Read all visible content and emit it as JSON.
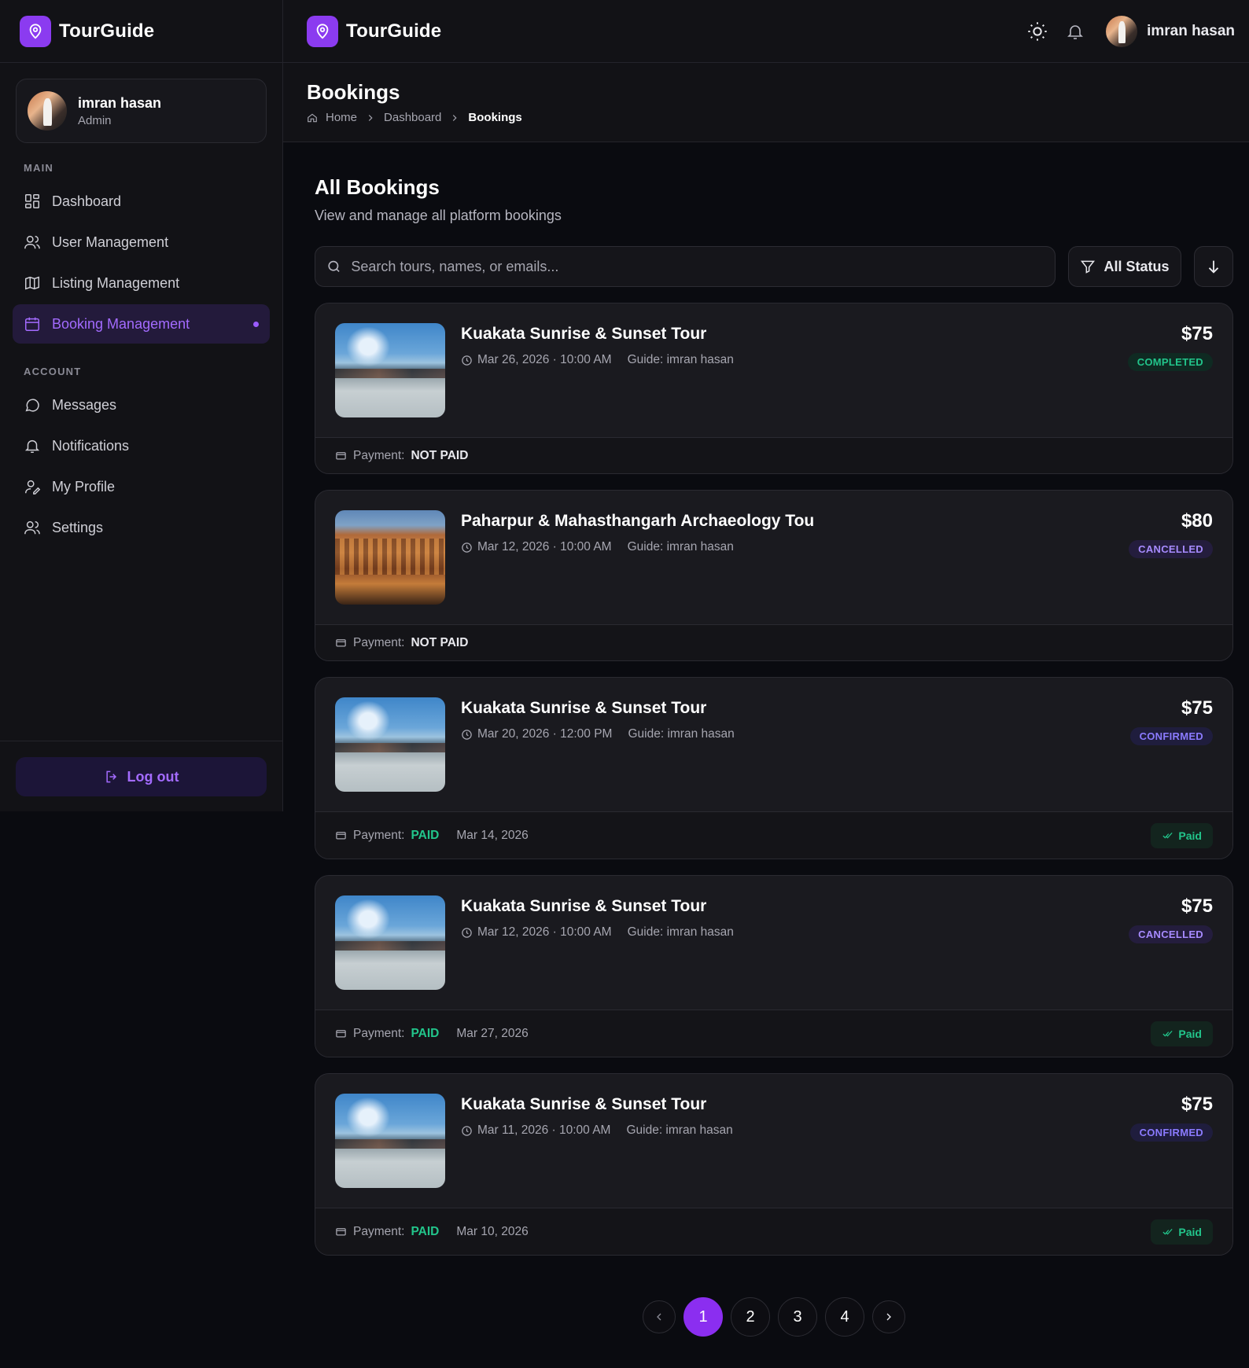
{
  "app": {
    "brand": "TourGuide"
  },
  "colors": {
    "accent": "#8b2ef0",
    "completed": "#22c58b",
    "cancelled": "#a78bff",
    "confirmed": "#8b7bff",
    "paid": "#22c58b"
  },
  "sidebar": {
    "user": {
      "name": "imran hasan",
      "role": "Admin"
    },
    "main_label": "MAIN",
    "main_items": [
      {
        "label": "Dashboard",
        "icon": "grid-icon"
      },
      {
        "label": "User Management",
        "icon": "users-icon"
      },
      {
        "label": "Listing Management",
        "icon": "map-icon"
      },
      {
        "label": "Booking Management",
        "icon": "calendar-icon",
        "active": true
      }
    ],
    "account_label": "ACCOUNT",
    "account_items": [
      {
        "label": "Messages",
        "icon": "chat-icon"
      },
      {
        "label": "Notifications",
        "icon": "bell-icon"
      },
      {
        "label": "My Profile",
        "icon": "profile-icon"
      },
      {
        "label": "Settings",
        "icon": "settings-icon"
      }
    ],
    "logout_label": "Log out"
  },
  "header": {
    "user_name": "imran hasan"
  },
  "page": {
    "title": "Bookings",
    "breadcrumb": [
      "Home",
      "Dashboard",
      "Bookings"
    ]
  },
  "main": {
    "title": "All Bookings",
    "subtitle": "View and manage all platform bookings",
    "search_placeholder": "Search tours, names, or emails...",
    "filter_label": "All Status"
  },
  "bookings": [
    {
      "title": "Kuakata Sunrise & Sunset Tour",
      "when": "Mar 26, 2026 · 10:00 AM",
      "guide": "Guide: imran hasan",
      "price": "$75",
      "status": "COMPLETED",
      "status_color": "#22c58b",
      "status_bg": "#0f2a22",
      "payment_label": "Payment:",
      "payment": "NOT PAID",
      "payment_color": "#e9e9ee",
      "payment_date": "",
      "paid_badge": "",
      "image": "beach"
    },
    {
      "title": "Paharpur & Mahasthangarh Archaeology Tou",
      "when": "Mar 12, 2026 · 10:00 AM",
      "guide": "Guide: imran hasan",
      "price": "$80",
      "status": "CANCELLED",
      "status_color": "#a78bff",
      "status_bg": "#241d3d",
      "payment_label": "Payment:",
      "payment": "NOT PAID",
      "payment_color": "#e9e9ee",
      "payment_date": "",
      "paid_badge": "",
      "image": "ruins"
    },
    {
      "title": "Kuakata Sunrise & Sunset Tour",
      "when": "Mar 20, 2026 · 12:00 PM",
      "guide": "Guide: imran hasan",
      "price": "$75",
      "status": "CONFIRMED",
      "status_color": "#8b7bff",
      "status_bg": "#1f1d3d",
      "payment_label": "Payment:",
      "payment": "PAID",
      "payment_color": "#22c58b",
      "payment_date": "Mar 14, 2026",
      "paid_badge": "Paid",
      "image": "beach"
    },
    {
      "title": "Kuakata Sunrise & Sunset Tour",
      "when": "Mar 12, 2026 · 10:00 AM",
      "guide": "Guide: imran hasan",
      "price": "$75",
      "status": "CANCELLED",
      "status_color": "#a78bff",
      "status_bg": "#241d3d",
      "payment_label": "Payment:",
      "payment": "PAID",
      "payment_color": "#22c58b",
      "payment_date": "Mar 27, 2026",
      "paid_badge": "Paid",
      "image": "beach"
    },
    {
      "title": "Kuakata Sunrise & Sunset Tour",
      "when": "Mar 11, 2026 · 10:00 AM",
      "guide": "Guide: imran hasan",
      "price": "$75",
      "status": "CONFIRMED",
      "status_color": "#8b7bff",
      "status_bg": "#1f1d3d",
      "payment_label": "Payment:",
      "payment": "PAID",
      "payment_color": "#22c58b",
      "payment_date": "Mar 10, 2026",
      "paid_badge": "Paid",
      "image": "beach"
    }
  ],
  "pagination": {
    "pages": [
      "1",
      "2",
      "3",
      "4"
    ],
    "current": "1"
  }
}
